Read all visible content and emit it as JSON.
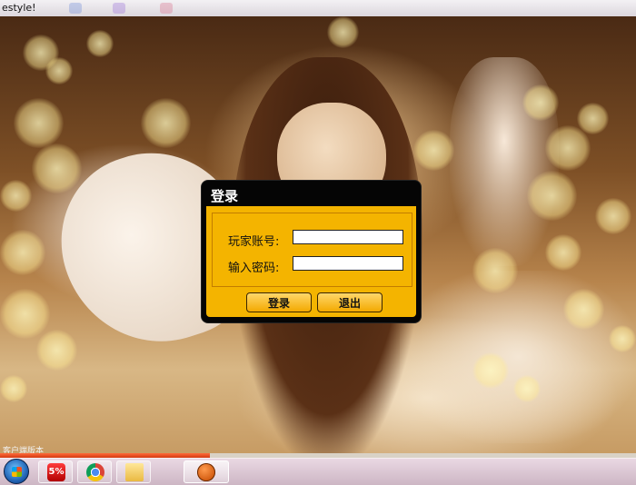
{
  "window": {
    "title": "estyle!"
  },
  "dialog": {
    "title": "登录",
    "account_label": "玩家账号:",
    "account_value": "",
    "password_label": "输入密码:",
    "password_value": "",
    "login_button": "登录",
    "exit_button": "退出"
  },
  "status": {
    "text": "客户端版本",
    "progress_percent": 33
  },
  "taskbar": {
    "items": [
      {
        "icon": "windows-start-icon"
      },
      {
        "icon": "game-launcher-icon",
        "label": "5%"
      },
      {
        "icon": "chrome-icon"
      },
      {
        "icon": "folder-icon"
      },
      {
        "icon": "basketball-icon"
      }
    ]
  },
  "colors": {
    "dialog_body": "#f4b400",
    "dialog_frame": "#050505",
    "button_top": "#ffd76a",
    "progress_fill": "#d33a10"
  }
}
